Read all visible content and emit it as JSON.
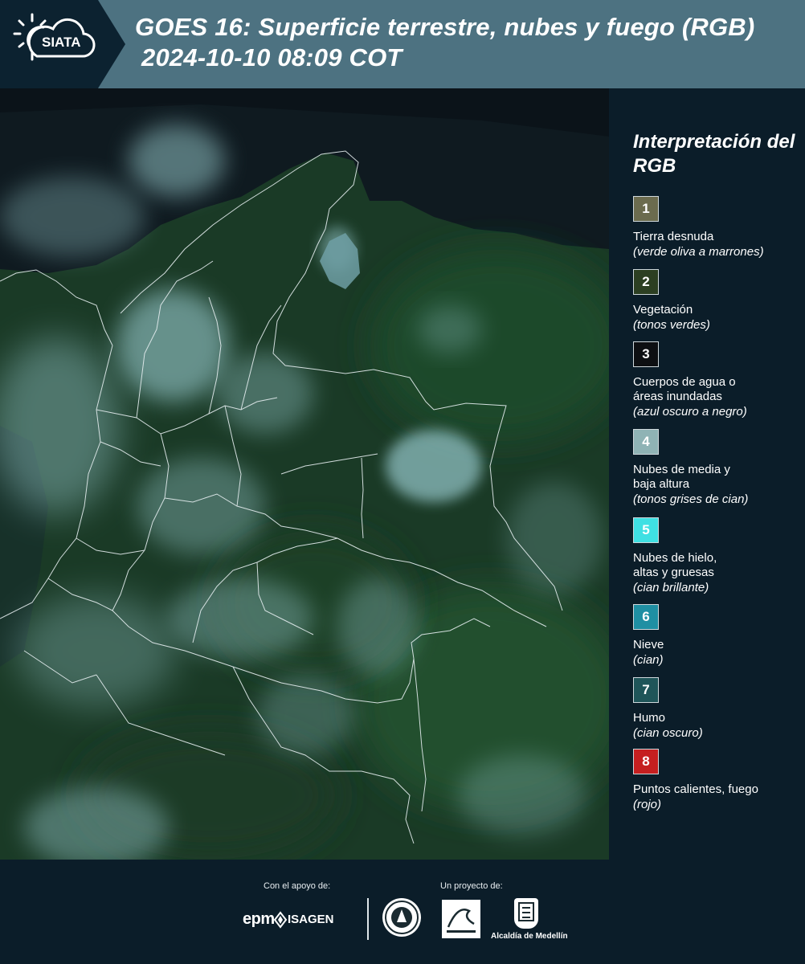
{
  "header": {
    "title_line1": "GOES 16: Superficie terrestre, nubes y fuego (RGB)",
    "title_line2": "2024-10-10 08:09 COT",
    "logo_text": "SIATA"
  },
  "legend": {
    "title": "Interpretación del RGB",
    "items": [
      {
        "number": "1",
        "color": "#6b6b4e",
        "label": "Tierra desnuda",
        "desc": "(verde oliva a marrones)"
      },
      {
        "number": "2",
        "color": "#2c3f22",
        "label": "Vegetación",
        "desc": "(tonos verdes)"
      },
      {
        "number": "3",
        "color": "#0d0f12",
        "label": "Cuerpos de agua o áreas inundadas",
        "desc": "(azul oscuro a negro)"
      },
      {
        "number": "4",
        "color": "#8fb3b5",
        "label": "Nubes de media y baja altura",
        "desc": "(tonos grises de cian)"
      },
      {
        "number": "5",
        "color": "#3fe0e3",
        "label": "Nubes de hielo, altas y gruesas",
        "desc": "(cian brillante)"
      },
      {
        "number": "6",
        "color": "#1f8fa3",
        "label": "Nieve",
        "desc": "(cian)"
      },
      {
        "number": "7",
        "color": "#1f5559",
        "label": "Humo",
        "desc": "(cian oscuro)"
      },
      {
        "number": "8",
        "color": "#c51f20",
        "label": "Puntos calientes, fuego",
        "desc": "(rojo)"
      }
    ]
  },
  "footer": {
    "support_label": "Con el apoyo de:",
    "project_label": "Un proyecto de:",
    "epm": "epm",
    "isagen": "ISAGEN",
    "alcaldia": "Alcaldía de Medellín"
  }
}
